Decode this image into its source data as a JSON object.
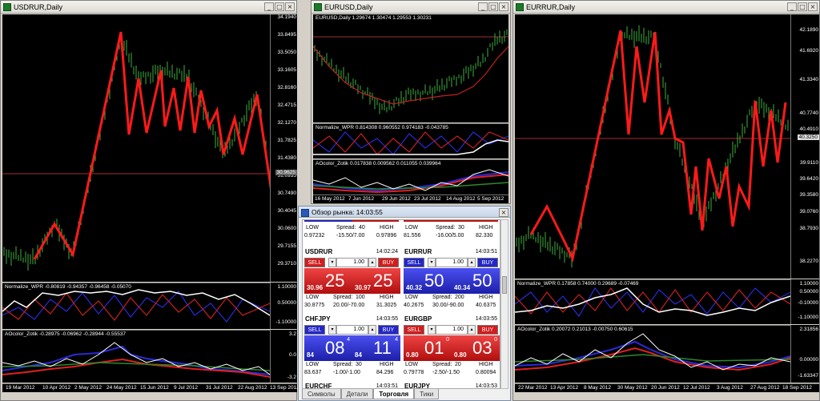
{
  "windows": {
    "usdrur": {
      "title": "USDRUR,Daily",
      "ind1": "Normalize_WPR -0.80819 -0.94357 -0.96458 -0.05070",
      "ind2": "AOcolor_Zotik -0.28975 -0.06962 -0.28944 -0.55537",
      "yticks": [
        "34.1940",
        "33.8495",
        "33.5050",
        "33.1605",
        "32.8160",
        "32.4715",
        "32.1270",
        "31.7825",
        "31.4380",
        "31.0935",
        "30.7490",
        "30.4045",
        "30.0600",
        "29.7155",
        "29.3710"
      ],
      "price_tag": "30.9625",
      "xticks": [
        "19 Mar 2012",
        "10 Apr 2012",
        "2 May 2012",
        "24 May 2012",
        "15 Jun 2012",
        "9 Jul 2012",
        "31 Jul 2012",
        "22 Aug 2012",
        "13 Sep 2012"
      ],
      "ind_yticks": [
        "1.10000",
        "0.50000",
        "-1.10000"
      ],
      "ao_yticks": [
        "3.2",
        "0.0",
        "-3.2"
      ]
    },
    "eurusd": {
      "title": "EURUSD,Daily",
      "info": "EURUSD,Daily  1.29674 1.30474 1.29553 1.30231",
      "ind1": "Normalize_WPR 0.814308 0.960552 0.974183 -0.043785",
      "ind2": "AOcolor_Zotik 0.017838 0.009562 0.011055 0.039964",
      "xticks": [
        "16 May 2012",
        "7 Jun 2012",
        "29 Jun 2012",
        "23 Jul 2012",
        "14 Aug 2012",
        "5 Sep 2012"
      ]
    },
    "eurrur": {
      "title": "EURRUR,Daily",
      "ind1": "Normalize_WPR 0.17858 0.74000 0.29689 -0.07469",
      "ind2": "AOcolor_Zotik 0.20072 0.21013 -0.00750 0.60615",
      "yticks": [
        "42.1890",
        "41.6920",
        "41.3340",
        "40.7740",
        "40.4910",
        "39.9110",
        "39.6420",
        "39.3580",
        "39.0760",
        "38.7930",
        "38.2270"
      ],
      "price_tag": "40.3250",
      "xticks": [
        "22 Mar 2012",
        "13 Apr 2012",
        "8 May 2012",
        "30 May 2012",
        "20 Jun 2012",
        "12 Jul 2012",
        "3 Aug 2012",
        "27 Aug 2012",
        "18 Sep 2012"
      ],
      "ind_yticks": [
        "1.10000",
        "0.50000",
        "-0.10000",
        "-1.10000"
      ],
      "ao_yticks": [
        "2.31856",
        "0.00000",
        "-1.63347"
      ]
    }
  },
  "market_watch": {
    "title": "Обзор рынка: 14:03:55",
    "labels": {
      "low": "LOW",
      "high": "HIGH",
      "spread": "Spread:",
      "sell": "SELL",
      "buy": "BUY"
    },
    "top_row": [
      {
        "low": "0.97232",
        "spread": "40",
        "range": "-15.50/7.00",
        "high": "0.97896"
      },
      {
        "low": "81.556",
        "spread": "30",
        "range": "-16.00/5.00",
        "high": "82.330"
      }
    ],
    "tiles": [
      {
        "symbol": "USDRUR",
        "time": "14:02:24",
        "lot": "1.00",
        "bid_small": "30.96",
        "bid_big": "25",
        "bid_sup": "",
        "ask_small": "30.97",
        "ask_big": "25",
        "ask_sup": "",
        "low": "30.8775",
        "spread": "100",
        "range": "20.00/-70.00",
        "high": "31.3025"
      },
      {
        "symbol": "EURRUR",
        "time": "14:03:51",
        "lot": "1.00",
        "bid_small": "40.32",
        "bid_big": "50",
        "bid_sup": "",
        "ask_small": "40.34",
        "ask_big": "50",
        "ask_sup": "",
        "low": "40.2675",
        "spread": "200",
        "range": "30.00/-90.00",
        "high": "40.6375"
      },
      {
        "symbol": "CHFJPY",
        "time": "14:03:55",
        "lot": "1.00",
        "bid_small": "84",
        "bid_big": "08",
        "bid_sup": "4",
        "ask_small": "84",
        "ask_big": "11",
        "ask_sup": "4",
        "low": "83.637",
        "spread": "30",
        "range": "-1.00/-1.00",
        "high": "84.296"
      },
      {
        "symbol": "EURGBP",
        "time": "14:03:55",
        "lot": "1.00",
        "bid_small": "0.80",
        "bid_big": "01",
        "bid_sup": "0",
        "ask_small": "0.80",
        "ask_big": "03",
        "ask_sup": "0",
        "low": "0.79778",
        "spread": "20",
        "range": "-2.50/-1.50",
        "high": "0.80094"
      }
    ],
    "bottom_row": [
      {
        "symbol": "EURCHF",
        "time": "14:03:51"
      },
      {
        "symbol": "EURJPY",
        "time": "14:03:53"
      }
    ],
    "tabs": [
      "Символы",
      "Детали",
      "Торговля",
      "Тики"
    ],
    "active_tab": "Торговля"
  }
}
